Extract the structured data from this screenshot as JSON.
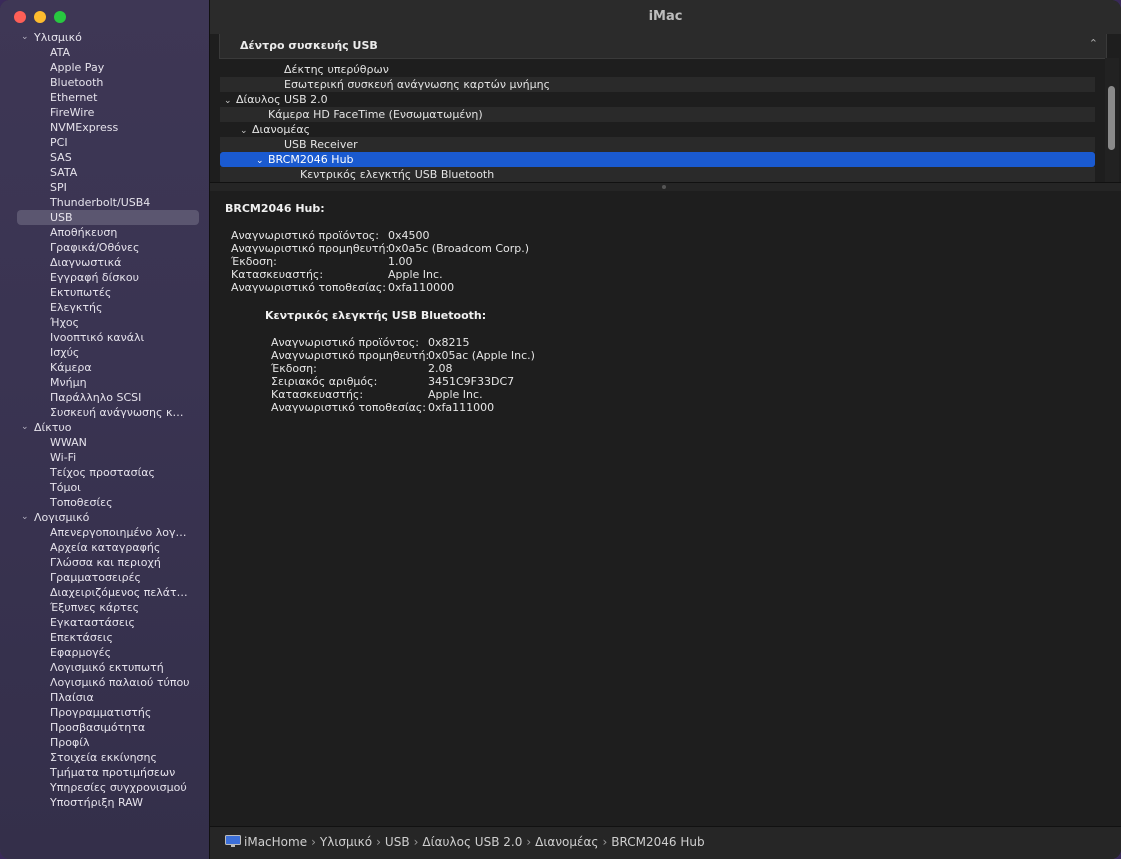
{
  "window": {
    "title": "iMac"
  },
  "sidebar": {
    "groups": [
      {
        "label": "Υλισμικό",
        "items": [
          "ATA",
          "Apple Pay",
          "Bluetooth",
          "Ethernet",
          "FireWire",
          "NVMExpress",
          "PCI",
          "SAS",
          "SATA",
          "SPI",
          "Thunderbolt/USB4",
          "USB",
          "Αποθήκευση",
          "Γραφικά/Οθόνες",
          "Διαγνωστικά",
          "Εγγραφή δίσκου",
          "Εκτυπωτές",
          "Ελεγκτής",
          "Ήχος",
          "Ιvοοπτικό κανάλι",
          "Ισχύς",
          "Κάμερα",
          "Μνήμη",
          "Παράλληλο SCSI",
          "Συσκευή ανάγνωσης καρ..."
        ]
      },
      {
        "label": "Δίκτυο",
        "items": [
          "WWAN",
          "Wi-Fi",
          "Τείχος προστασίας",
          "Τόμοι",
          "Τοποθεσίες"
        ]
      },
      {
        "label": "Λογισμικό",
        "items": [
          "Απενεργοποιημένο λογισ...",
          "Αρχεία καταγραφής",
          "Γλώσσα και περιοχή",
          "Γραμματοσειρές",
          "Διαχειριζόμενος πελάτης",
          "Έξυπνες κάρτες",
          "Εγκαταστάσεις",
          "Επεκτάσεις",
          "Εφαρμογές",
          "Λογισμικό εκτυπωτή",
          "Λογισμικό παλαιού τύπου",
          "Πλαίσια",
          "Προγραμματιστής",
          "Προσβασιμότητα",
          "Προφίλ",
          "Στοιχεία εκκίνησης",
          "Τμήματα προτιμήσεων",
          "Υπηρεσίες συγχρονισμού",
          "Υποστήριξη RAW"
        ]
      }
    ],
    "selected": "USB"
  },
  "usb_tree": {
    "header": "Δέντρο συσκευής USB",
    "rows": [
      {
        "label": "Δέκτης υπερύθρων",
        "indent": 3,
        "chevron": ""
      },
      {
        "label": "Εσωτερική συσκευή ανάγνωσης καρτών μνήμης",
        "indent": 3,
        "chevron": ""
      },
      {
        "label": "Δίαυλος USB 2.0",
        "indent": 0,
        "chevron": "⌄"
      },
      {
        "label": "Κάμερα HD FaceTime (Ενσωματωμένη)",
        "indent": 2,
        "chevron": ""
      },
      {
        "label": "Διανομέας",
        "indent": 1,
        "chevron": "⌄"
      },
      {
        "label": "USB Receiver",
        "indent": 3,
        "chevron": ""
      },
      {
        "label": "BRCM2046 Hub",
        "indent": 2,
        "chevron": "⌄",
        "selected": true
      },
      {
        "label": "Κεντρικός ελεγκτής USB Bluetooth",
        "indent": 4,
        "chevron": ""
      }
    ]
  },
  "detail": {
    "title": "BRCM2046 Hub:",
    "fields": [
      {
        "key": "Αναγνωριστικό προϊόντος:",
        "value": "0x4500"
      },
      {
        "key": "Αναγνωριστικό προμηθευτή:",
        "value": "0x0a5c  (Broadcom Corp.)"
      },
      {
        "key": "Έκδοση:",
        "value": "1.00"
      },
      {
        "key": "Κατασκευαστής:",
        "value": "Apple Inc."
      },
      {
        "key": "Αναγνωριστικό τοποθεσίας:",
        "value": "0xfa110000"
      }
    ],
    "sub": {
      "title": "Κεντρικός ελεγκτής USB Bluetooth:",
      "fields": [
        {
          "key": "Αναγνωριστικό προϊόντος:",
          "value": "0x8215"
        },
        {
          "key": "Αναγνωριστικό προμηθευτή:",
          "value": "0x05ac (Apple Inc.)"
        },
        {
          "key": "Έκδοση:",
          "value": "2.08"
        },
        {
          "key": "Σειριακός αριθμός:",
          "value": "3451C9F33DC7"
        },
        {
          "key": "Κατασκευαστής:",
          "value": "Apple Inc."
        },
        {
          "key": "Αναγνωριστικό τοποθεσίας:",
          "value": "0xfa111000"
        }
      ]
    }
  },
  "pathbar": {
    "icon": "imac-icon",
    "segments": [
      "iMacHome",
      "Υλισμικό",
      "USB",
      "Δίαυλος USB 2.0",
      "Διανομέας",
      "BRCM2046 Hub"
    ],
    "separator": "›"
  }
}
